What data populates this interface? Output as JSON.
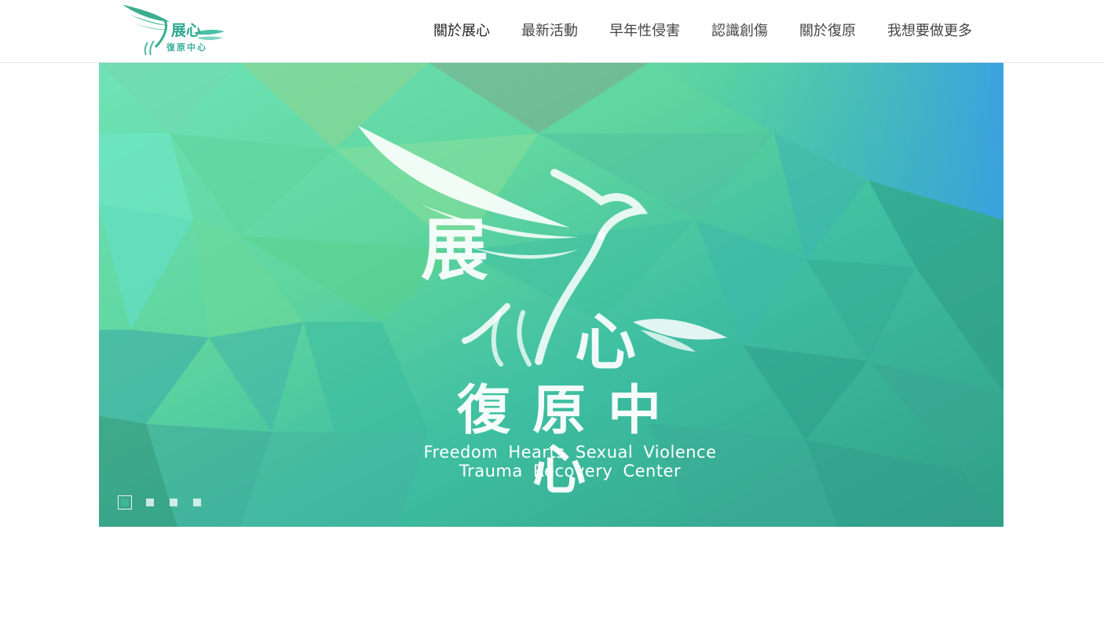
{
  "brand": {
    "logo_main": "展心",
    "logo_sub": "復原中心"
  },
  "nav": {
    "items": [
      {
        "label": "關於展心"
      },
      {
        "label": "最新活動"
      },
      {
        "label": "早年性侵害"
      },
      {
        "label": "認識創傷"
      },
      {
        "label": "關於復原"
      },
      {
        "label": "我想要做更多"
      }
    ]
  },
  "hero": {
    "logo_char_1": "展",
    "logo_char_2": "心",
    "title": "復原中心",
    "en_line_1": "Freedom  Hearts  Sexual  Violence",
    "en_line_2": "Trauma  Recovery  Center",
    "slides_count": 4,
    "active_slide": 1
  },
  "colors": {
    "accent": "#3db796",
    "nav_text": "#444444",
    "hero_text": "#ffffff"
  },
  "icons": {
    "logo": "phoenix-wings-icon",
    "hero_emblem": "phoenix-wings-icon"
  }
}
